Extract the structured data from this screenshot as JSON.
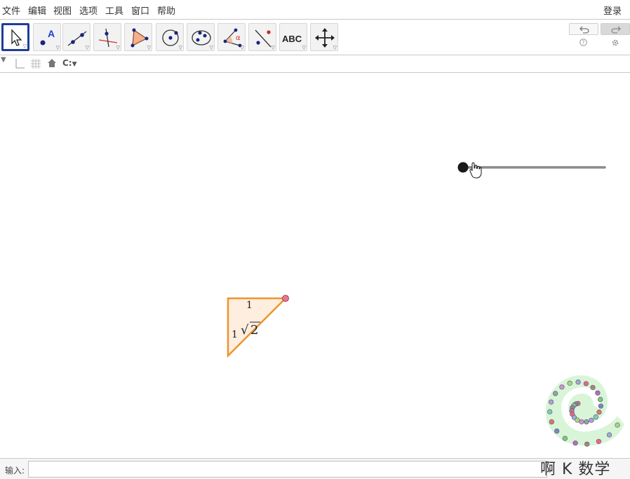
{
  "menubar": {
    "items": [
      "文件",
      "编辑",
      "视图",
      "选项",
      "工具",
      "窗口",
      "帮助"
    ],
    "login": "登录"
  },
  "toolbar": {
    "tools": [
      {
        "name": "move-tool",
        "icon": "arrow-cursor-icon"
      },
      {
        "name": "point-tool",
        "icon": "point-icon",
        "text": "A"
      },
      {
        "name": "line-tool",
        "icon": "line-icon"
      },
      {
        "name": "perpendicular-tool",
        "icon": "perpendicular-line-icon"
      },
      {
        "name": "polygon-tool",
        "icon": "polygon-icon"
      },
      {
        "name": "circle-tool",
        "icon": "circle-center-point-icon"
      },
      {
        "name": "ellipse-tool",
        "icon": "ellipse-icon"
      },
      {
        "name": "angle-tool",
        "icon": "angle-icon",
        "text": "α"
      },
      {
        "name": "reflect-tool",
        "icon": "reflect-line-icon"
      },
      {
        "name": "text-tool",
        "icon": "text-icon",
        "text": "ABC"
      },
      {
        "name": "move-view-tool",
        "icon": "move-graphics-view-icon"
      }
    ]
  },
  "stylebar": {
    "icons": [
      "toggle-stylebar-icon",
      "axes-icon",
      "grid-icon",
      "home-icon",
      "point-capture-icon"
    ],
    "capture_label": "C:"
  },
  "canvas": {
    "triangle": {
      "side_top": "1",
      "side_left": "1",
      "hypotenuse_radical": "√",
      "hypotenuse_value": "2",
      "fill": "#fdeee0",
      "stroke": "#f0932b",
      "vertex_color": "#e8768f"
    },
    "slider": {
      "value_fraction": 0.0,
      "track_color": "#8a8a8a",
      "knob_color": "#1a1a1a"
    }
  },
  "inputbar": {
    "label": "输入:",
    "value": ""
  },
  "watermark": "啊 K 数学",
  "colors": {
    "accent": "#1f3d99",
    "logo_green": "#d8f5d8"
  }
}
